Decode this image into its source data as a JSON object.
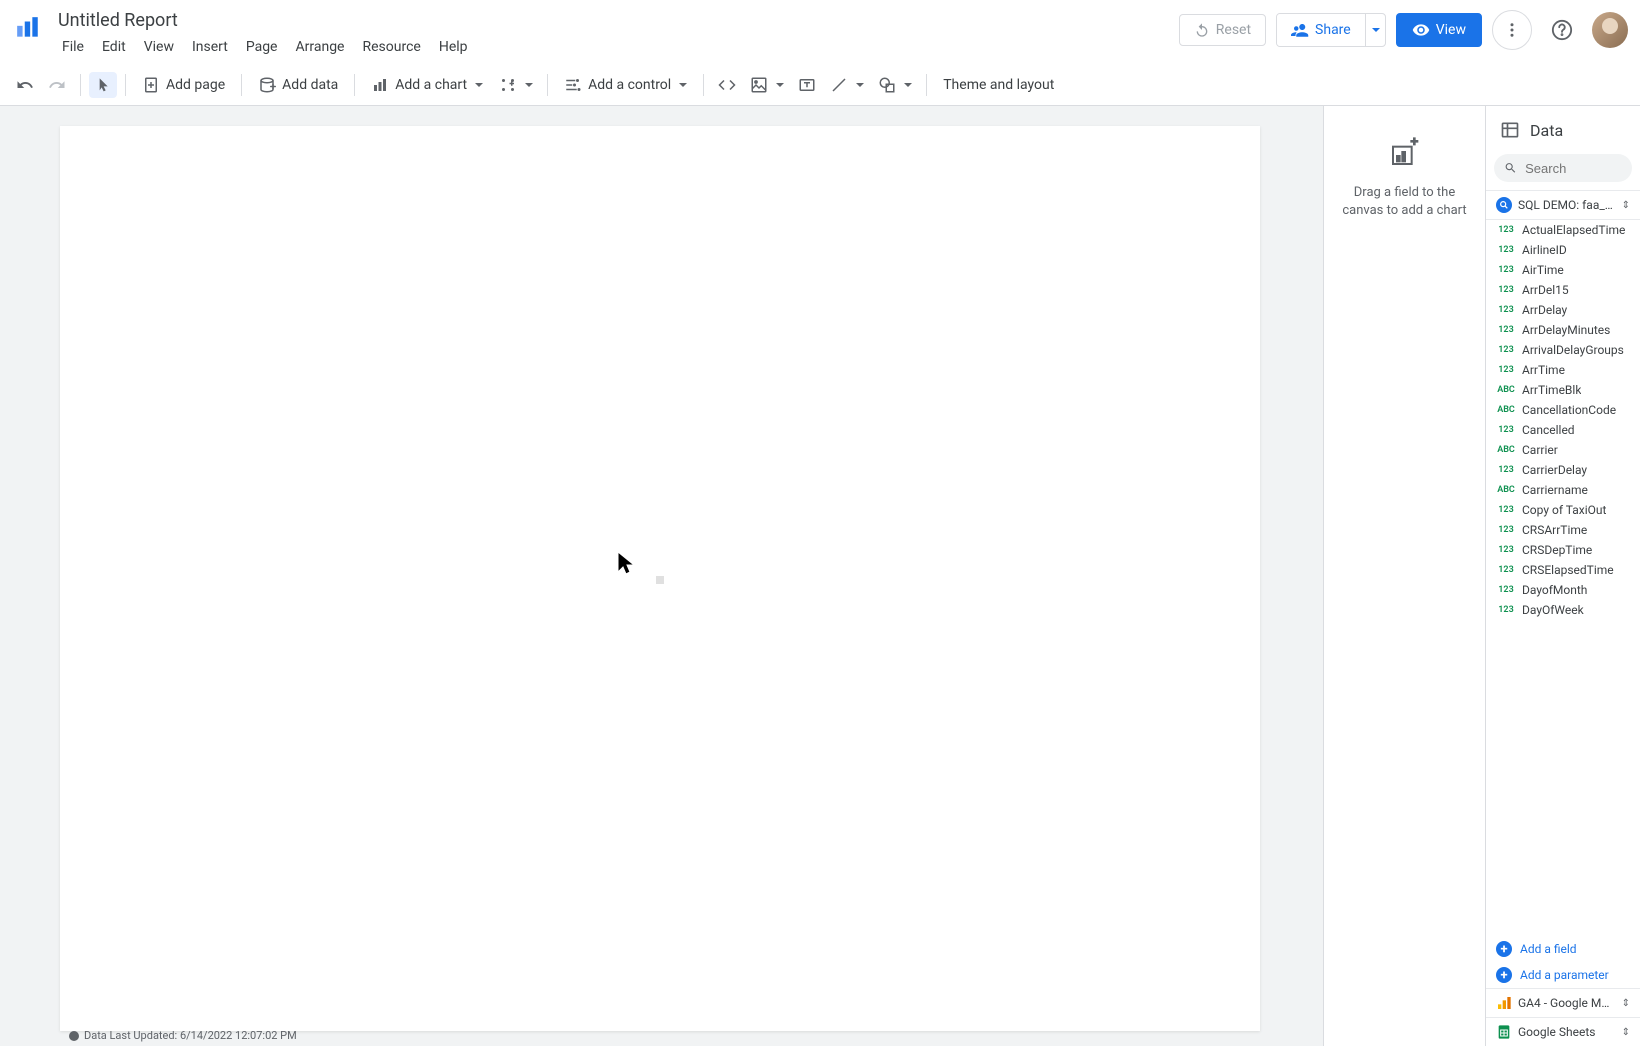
{
  "header": {
    "title": "Untitled Report",
    "menu": [
      "File",
      "Edit",
      "View",
      "Insert",
      "Page",
      "Arrange",
      "Resource",
      "Help"
    ],
    "reset": "Reset",
    "share": "Share",
    "view": "View"
  },
  "toolbar": {
    "add_page": "Add page",
    "add_data": "Add data",
    "add_chart": "Add a chart",
    "add_control": "Add a control",
    "theme": "Theme and layout"
  },
  "chart_hint": {
    "text": "Drag a field to the canvas to add a chart"
  },
  "data_panel": {
    "title": "Data",
    "search_placeholder": "Search",
    "source_name": "SQL DEMO: faa_fli...",
    "fields": [
      {
        "type": "123",
        "name": "ActualElapsedTime"
      },
      {
        "type": "123",
        "name": "AirlineID"
      },
      {
        "type": "123",
        "name": "AirTime"
      },
      {
        "type": "123",
        "name": "ArrDel15"
      },
      {
        "type": "123",
        "name": "ArrDelay"
      },
      {
        "type": "123",
        "name": "ArrDelayMinutes"
      },
      {
        "type": "123",
        "name": "ArrivalDelayGroups"
      },
      {
        "type": "123",
        "name": "ArrTime"
      },
      {
        "type": "ABC",
        "name": "ArrTimeBlk"
      },
      {
        "type": "ABC",
        "name": "CancellationCode"
      },
      {
        "type": "123",
        "name": "Cancelled"
      },
      {
        "type": "ABC",
        "name": "Carrier"
      },
      {
        "type": "123",
        "name": "CarrierDelay"
      },
      {
        "type": "ABC",
        "name": "Carriername"
      },
      {
        "type": "123",
        "name": "Copy of TaxiOut"
      },
      {
        "type": "123",
        "name": "CRSArrTime"
      },
      {
        "type": "123",
        "name": "CRSDepTime"
      },
      {
        "type": "123",
        "name": "CRSElapsedTime"
      },
      {
        "type": "123",
        "name": "DayofMonth"
      },
      {
        "type": "123",
        "name": "DayOfWeek"
      }
    ],
    "add_field": "Add a field",
    "add_parameter": "Add a parameter",
    "other_sources": [
      {
        "name": "GA4 - Google Merc...",
        "icon": "ga"
      },
      {
        "name": "Google Sheets",
        "icon": "sheets"
      }
    ]
  },
  "status": {
    "text": "Data Last Updated: 6/14/2022 12:07:02 PM"
  }
}
